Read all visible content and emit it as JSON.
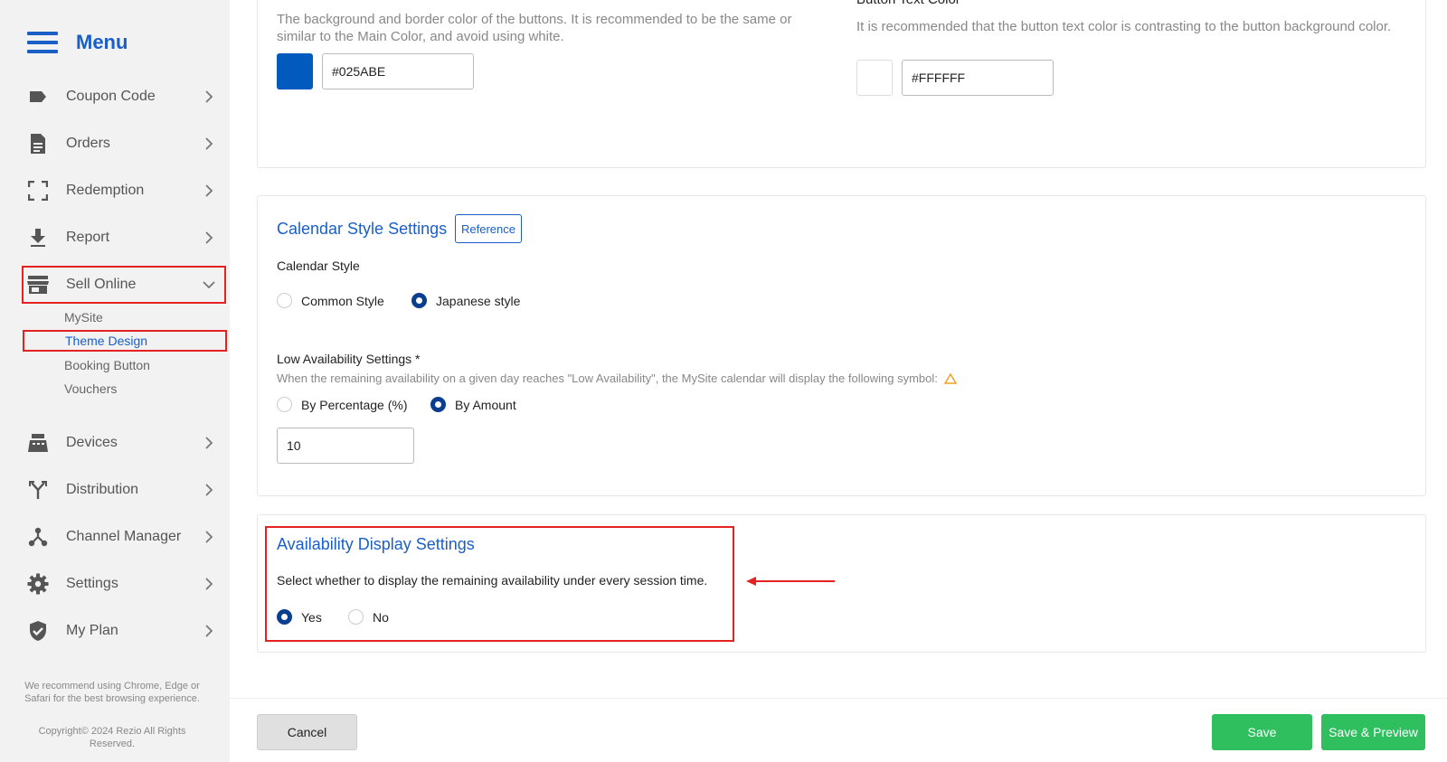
{
  "sidebar": {
    "title": "Menu",
    "items": [
      {
        "label": "Coupon Code",
        "icon": "tag-icon"
      },
      {
        "label": "Orders",
        "icon": "document-icon"
      },
      {
        "label": "Redemption",
        "icon": "scan-frame-icon"
      },
      {
        "label": "Report",
        "icon": "download-icon"
      },
      {
        "label": "Sell Online",
        "icon": "store-icon"
      },
      {
        "label": "Devices",
        "icon": "pos-terminal-icon"
      },
      {
        "label": "Distribution",
        "icon": "fork-icon"
      },
      {
        "label": "Channel Manager",
        "icon": "network-icon"
      },
      {
        "label": "Settings",
        "icon": "gear-icon"
      },
      {
        "label": "My Plan",
        "icon": "shield-check-icon"
      }
    ],
    "sell_online_sub": [
      "MySite",
      "Theme Design",
      "Booking Button",
      "Vouchers"
    ],
    "recommend_note": "We recommend using Chrome, Edge or Safari for the best browsing experience.",
    "copyright": "Copyright© 2024 Rezio All Rights Reserved."
  },
  "button_colors": {
    "left_desc": "The background and border color of the buttons. It is recommended to be the same or similar to the Main Color, and avoid using white.",
    "left_value": "#025ABE",
    "left_color": "#025ABE",
    "right_title": "Button Text Color",
    "right_desc": "It is recommended that the button text color is contrasting to the button background color.",
    "right_value": "#FFFFFF",
    "right_color": "#FFFFFF"
  },
  "calendar": {
    "title": "Calendar Style Settings",
    "reference_label": "Reference",
    "style_label": "Calendar Style",
    "options": [
      "Common Style",
      "Japanese style"
    ],
    "selected": "Japanese style",
    "low_title": "Low Availability Settings *",
    "low_desc": "When the remaining availability on a given day reaches \"Low Availability\", the MySite calendar will display the following symbol:",
    "low_options": [
      "By Percentage (%)",
      "By Amount"
    ],
    "low_selected": "By Amount",
    "low_value": "10"
  },
  "availability": {
    "title": "Availability Display Settings",
    "desc": "Select whether to display the remaining availability under every session time.",
    "options": [
      "Yes",
      "No"
    ],
    "selected": "Yes"
  },
  "footer": {
    "cancel": "Cancel",
    "save": "Save",
    "save_preview": "Save & Preview"
  },
  "colors": {
    "brand_blue": "#1a5fc8",
    "highlight_red": "#e52222",
    "save_green": "#2fbf5f"
  }
}
